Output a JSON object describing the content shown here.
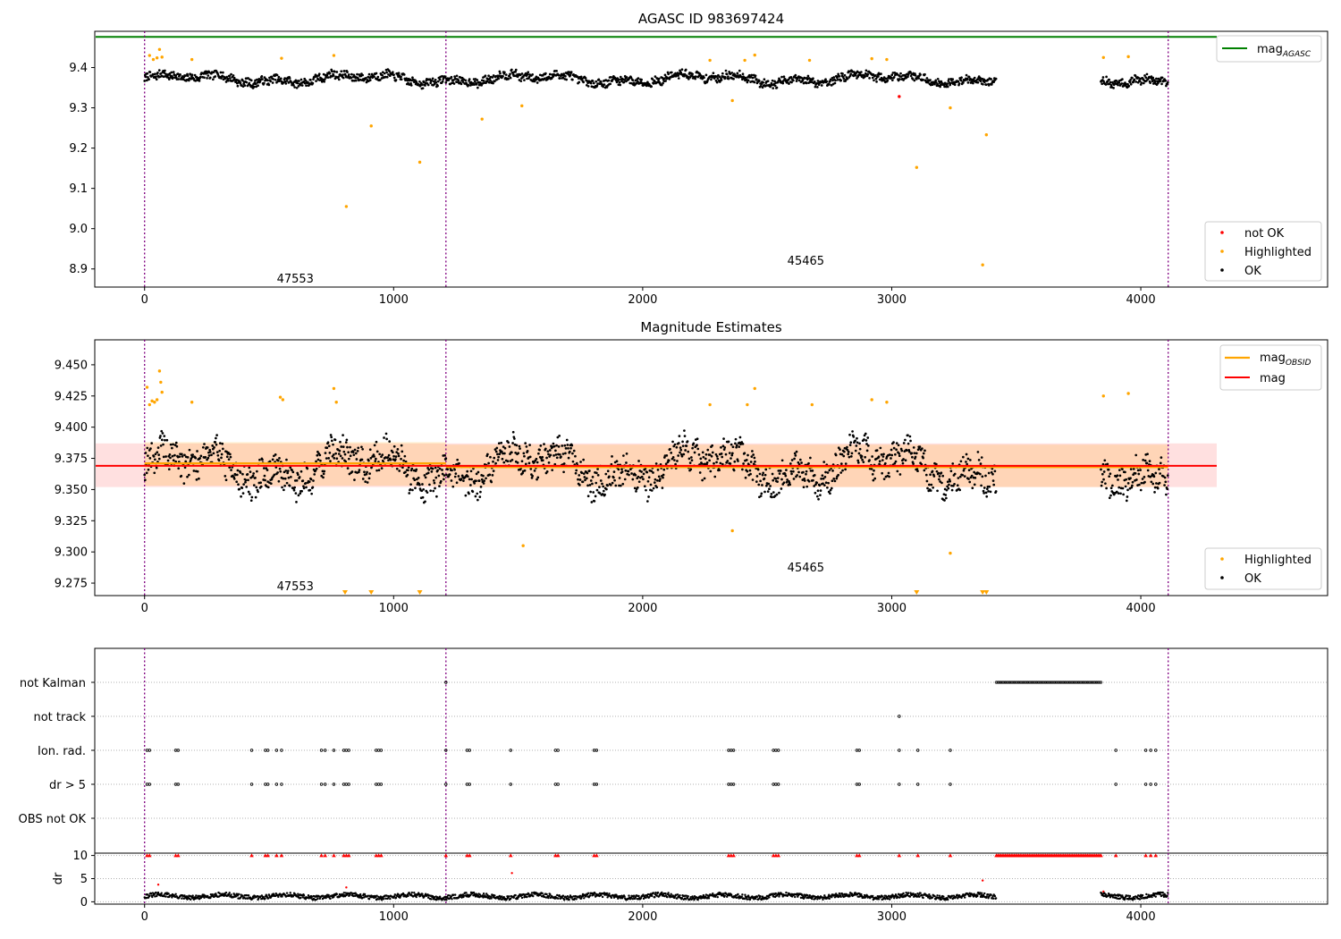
{
  "chart_data": [
    {
      "type": "scatter",
      "title": "AGASC ID 983697424",
      "xlabel": "",
      "ylabel": "",
      "xlim": [
        -200,
        4750
      ],
      "ylim": [
        8.855,
        9.49
      ],
      "x_ticks": [
        0,
        1000,
        2000,
        3000,
        4000
      ],
      "y_ticks": [
        8.9,
        9.0,
        9.1,
        9.2,
        9.3,
        9.4
      ],
      "grid": false,
      "hlines": [
        {
          "name": "mag_AGASC",
          "y": 9.476,
          "x_range": [
            -200,
            4750
          ],
          "color": "#008000"
        }
      ],
      "vlines": [
        0,
        1210,
        4110
      ],
      "obsid_labels": [
        {
          "text": "47553",
          "x": 605,
          "y": 8.877
        },
        {
          "text": "45465",
          "x": 2655,
          "y": 8.922
        }
      ],
      "series": [
        {
          "name": "not OK",
          "color": "#ff0000",
          "points": [
            [
              3030,
              9.328
            ]
          ]
        },
        {
          "name": "Highlighted",
          "color": "#ffa500",
          "points": [
            [
              20,
              9.43
            ],
            [
              35,
              9.42
            ],
            [
              50,
              9.424
            ],
            [
              60,
              9.445
            ],
            [
              70,
              9.426
            ],
            [
              190,
              9.42
            ],
            [
              550,
              9.423
            ],
            [
              760,
              9.43
            ],
            [
              810,
              9.055
            ],
            [
              910,
              9.255
            ],
            [
              1105,
              9.165
            ],
            [
              1355,
              9.272
            ],
            [
              1515,
              9.305
            ],
            [
              2270,
              9.418
            ],
            [
              2360,
              9.318
            ],
            [
              2410,
              9.418
            ],
            [
              2450,
              9.431
            ],
            [
              2670,
              9.418
            ],
            [
              2920,
              9.422
            ],
            [
              2980,
              9.42
            ],
            [
              3100,
              9.152
            ],
            [
              3235,
              9.3
            ],
            [
              3365,
              8.91
            ],
            [
              3380,
              9.233
            ],
            [
              3850,
              9.425
            ],
            [
              3950,
              9.427
            ]
          ]
        },
        {
          "name": "OK",
          "color": "#000000",
          "band": {
            "center": 9.372,
            "spread": 0.018
          },
          "segments": [
            [
              0,
              3420
            ],
            [
              3840,
              4110
            ]
          ]
        }
      ],
      "legend": {
        "position": "top-right and bottom-right",
        "entries": [
          "mag_AGASC",
          "not OK",
          "Highlighted",
          "OK"
        ]
      }
    },
    {
      "type": "scatter",
      "title": "Magnitude Estimates",
      "xlabel": "",
      "ylabel": "",
      "xlim": [
        -200,
        4750
      ],
      "ylim": [
        9.265,
        9.47
      ],
      "x_ticks": [
        0,
        1000,
        2000,
        3000,
        4000
      ],
      "y_ticks": [
        9.275,
        9.3,
        9.325,
        9.35,
        9.375,
        9.4,
        9.425,
        9.45
      ],
      "grid": false,
      "mag": 9.369,
      "mag_band": [
        9.352,
        9.387
      ],
      "mag_obsid": [
        {
          "x_range": [
            0,
            1210
          ],
          "value": 9.371,
          "band": [
            9.353,
            9.388
          ]
        },
        {
          "x_range": [
            1210,
            4110
          ],
          "value": 9.368,
          "band": [
            9.352,
            9.386
          ]
        }
      ],
      "vlines": [
        0,
        1210,
        4110
      ],
      "obsid_labels": [
        {
          "text": "47553",
          "x": 605,
          "y": 9.273
        },
        {
          "text": "45465",
          "x": 2655,
          "y": 9.288
        }
      ],
      "series": [
        {
          "name": "Highlighted",
          "color": "#ffa500",
          "points": [
            [
              10,
              9.432
            ],
            [
              20,
              9.418
            ],
            [
              30,
              9.421
            ],
            [
              40,
              9.42
            ],
            [
              50,
              9.422
            ],
            [
              60,
              9.445
            ],
            [
              65,
              9.436
            ],
            [
              70,
              9.428
            ],
            [
              190,
              9.42
            ],
            [
              545,
              9.424
            ],
            [
              555,
              9.422
            ],
            [
              760,
              9.431
            ],
            [
              770,
              9.42
            ],
            [
              1520,
              9.305
            ],
            [
              2270,
              9.418
            ],
            [
              2360,
              9.317
            ],
            [
              2420,
              9.418
            ],
            [
              2450,
              9.431
            ],
            [
              2680,
              9.418
            ],
            [
              2920,
              9.422
            ],
            [
              2980,
              9.42
            ],
            [
              3235,
              9.299
            ],
            [
              3850,
              9.425
            ],
            [
              3950,
              9.427
            ]
          ]
        },
        {
          "name": "Highlighted below range",
          "color": "#ffa500",
          "marker": "triangle-down",
          "points": [
            [
              805,
              9.265
            ],
            [
              910,
              9.265
            ],
            [
              1105,
              9.265
            ],
            [
              3100,
              9.265
            ],
            [
              3365,
              9.265
            ],
            [
              3380,
              9.265
            ]
          ]
        },
        {
          "name": "OK",
          "color": "#000000",
          "band": {
            "center": 9.368,
            "spread": 0.022
          },
          "segments": [
            [
              0,
              3420
            ],
            [
              3840,
              4110
            ]
          ]
        }
      ],
      "legend": {
        "position": "top-right and bottom-right",
        "entries": [
          "mag_OBSID",
          "mag",
          "Highlighted",
          "OK"
        ]
      }
    },
    {
      "type": "scatter",
      "title": "",
      "xlabel": "",
      "ylabel": "",
      "xlim": [
        -200,
        4750
      ],
      "categories": [
        "not Kalman",
        "not track",
        "Ion. rad.",
        "dr > 5",
        "OBS not OK"
      ],
      "grid": true,
      "vlines": [
        0,
        1210,
        4110
      ],
      "flags": {
        "not Kalman": {
          "x": [
            1210
          ],
          "range": [
            3420,
            3840
          ]
        },
        "not track": {
          "x": [
            3030
          ]
        },
        "Ion. rad.": {
          "x": [
            10,
            20,
            125,
            135,
            430,
            485,
            495,
            530,
            550,
            710,
            725,
            760,
            800,
            810,
            820,
            930,
            940,
            950,
            1210,
            1295,
            1305,
            1470,
            1650,
            1660,
            1805,
            1815,
            2345,
            2355,
            2365,
            2525,
            2535,
            2545,
            2860,
            2870,
            3030,
            3105,
            3235,
            3900,
            4020,
            4040,
            4060
          ]
        },
        "dr > 5": {
          "x": [
            10,
            20,
            125,
            135,
            430,
            485,
            495,
            530,
            550,
            710,
            725,
            760,
            800,
            810,
            820,
            930,
            940,
            950,
            1210,
            1295,
            1305,
            1470,
            1650,
            1660,
            1805,
            1815,
            2345,
            2355,
            2365,
            2525,
            2535,
            2545,
            2860,
            2870,
            3030,
            3105,
            3235,
            3900,
            4020,
            4040,
            4060
          ]
        },
        "OBS not OK": {
          "x": []
        }
      }
    },
    {
      "type": "scatter",
      "title": "",
      "xlabel": "",
      "ylabel": "dr",
      "xlim": [
        -200,
        4750
      ],
      "ylim": [
        -0.5,
        10.5
      ],
      "x_ticks": [
        0,
        1000,
        2000,
        3000,
        4000
      ],
      "y_ticks": [
        0,
        5,
        10
      ],
      "grid": true,
      "vlines": [
        0,
        1210,
        4110
      ],
      "series": [
        {
          "name": "dr capped",
          "color": "#ff0000",
          "value": 10,
          "x": [
            10,
            20,
            125,
            135,
            430,
            485,
            495,
            530,
            550,
            710,
            725,
            760,
            800,
            810,
            820,
            930,
            940,
            950,
            1210,
            1295,
            1305,
            1470,
            1650,
            1660,
            1805,
            1815,
            2345,
            2355,
            2365,
            2525,
            2535,
            2545,
            2860,
            2870,
            3030,
            3105,
            3235,
            3900,
            4020,
            4040,
            4060
          ],
          "range": [
            3420,
            3840
          ]
        },
        {
          "name": "dr outliers",
          "color": "#ff0000",
          "points": [
            [
              55,
              3.7
            ],
            [
              810,
              3.1
            ],
            [
              1475,
              6.2
            ],
            [
              3365,
              4.6
            ],
            [
              3850,
              2.2
            ]
          ]
        },
        {
          "name": "dr",
          "color": "#000000",
          "band": {
            "center": 1.2,
            "spread": 0.6
          },
          "segments": [
            [
              0,
              3420
            ],
            [
              3840,
              4110
            ]
          ]
        }
      ]
    }
  ]
}
